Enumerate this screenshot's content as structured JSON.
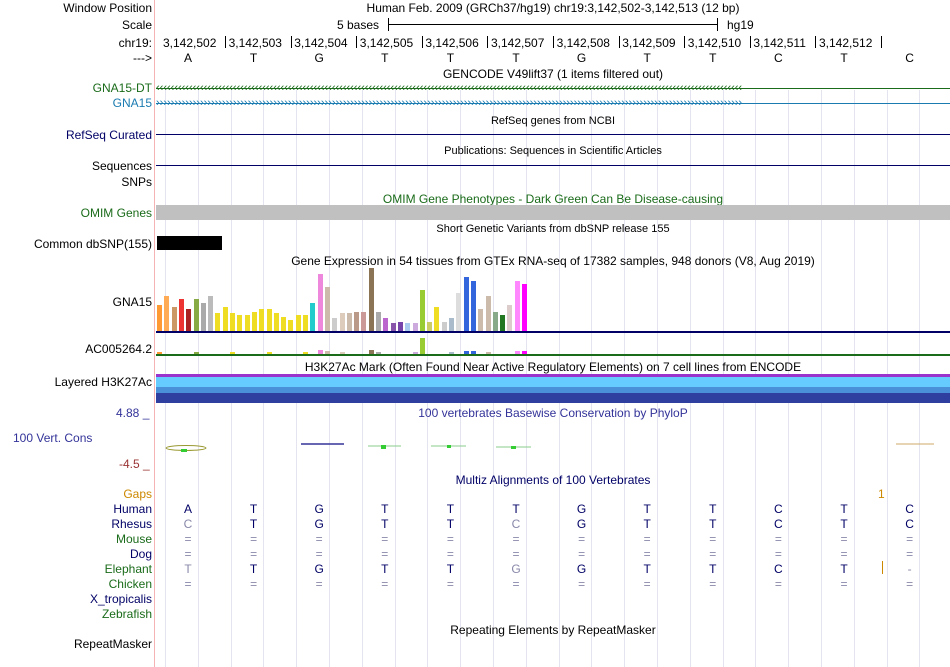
{
  "header": {
    "window_position_label": "Window Position",
    "window_position_value": "Human Feb. 2009 (GRCh37/hg19)   chr19:3,142,502-3,142,513 (12 bp)",
    "scale_label": "Scale",
    "scale_value": "5 bases",
    "scale_assembly": "hg19",
    "chrom_label": "chr19:",
    "arrow_label": "--->",
    "positions": [
      "3,142,502",
      "3,142,503",
      "3,142,504",
      "3,142,505",
      "3,142,506",
      "3,142,507",
      "3,142,508",
      "3,142,509",
      "3,142,510",
      "3,142,511",
      "3,142,512"
    ],
    "bases": [
      "A",
      "T",
      "G",
      "T",
      "T",
      "T",
      "G",
      "T",
      "T",
      "C",
      "T",
      "C"
    ]
  },
  "gencode": {
    "title": "GENCODE V49lift37 (1 items filtered out)",
    "tracks": [
      {
        "label": "GNA15-DT",
        "color": "#1a6b1a",
        "arrow": "‹"
      },
      {
        "label": "GNA15",
        "color": "#1a7bb0",
        "arrow": "›"
      }
    ]
  },
  "refseq": {
    "title": "RefSeq genes from NCBI",
    "label": "RefSeq Curated"
  },
  "publications": {
    "title": "Publications: Sequences in Scientific Articles",
    "label": "Sequences"
  },
  "snps": {
    "label": "SNPs"
  },
  "omim": {
    "title": "OMIM Gene Phenotypes - Dark Green Can Be Disease-causing",
    "label": "OMIM Genes"
  },
  "dbsnp": {
    "title": "Short Genetic Variants from dbSNP release 155",
    "label": "Common dbSNP(155)"
  },
  "gtex": {
    "title": "Gene Expression in 54 tissues from GTEx RNA-seq of 17382 samples, 948 donors (V8, Aug 2019)",
    "gene1": "GNA15",
    "gene2": "AC005264.2",
    "bars": [
      {
        "v": 0.42,
        "c": "#ff9933"
      },
      {
        "v": 0.55,
        "c": "#ffaa55"
      },
      {
        "v": 0.38,
        "c": "#cc9966"
      },
      {
        "v": 0.5,
        "c": "#ee3333"
      },
      {
        "v": 0.35,
        "c": "#aa2222"
      },
      {
        "v": 0.5,
        "c": "#88aa44"
      },
      {
        "v": 0.45,
        "c": "#aaaaaa"
      },
      {
        "v": 0.55,
        "c": "#bbbbbb"
      },
      {
        "v": 0.28,
        "c": "#eedd22"
      },
      {
        "v": 0.38,
        "c": "#eedd22"
      },
      {
        "v": 0.28,
        "c": "#eedd22"
      },
      {
        "v": 0.25,
        "c": "#eedd22"
      },
      {
        "v": 0.25,
        "c": "#eedd22"
      },
      {
        "v": 0.3,
        "c": "#eedd22"
      },
      {
        "v": 0.35,
        "c": "#eedd22"
      },
      {
        "v": 0.35,
        "c": "#eedd22"
      },
      {
        "v": 0.28,
        "c": "#eedd22"
      },
      {
        "v": 0.22,
        "c": "#eedd22"
      },
      {
        "v": 0.18,
        "c": "#eedd22"
      },
      {
        "v": 0.25,
        "c": "#eedd22"
      },
      {
        "v": 0.25,
        "c": "#eedd22"
      },
      {
        "v": 0.45,
        "c": "#22cccc"
      },
      {
        "v": 0.9,
        "c": "#ee88dd"
      },
      {
        "v": 0.7,
        "c": "#ccbbaa"
      },
      {
        "v": 0.2,
        "c": "#cccccc"
      },
      {
        "v": 0.28,
        "c": "#ddccbb"
      },
      {
        "v": 0.28,
        "c": "#ccbbaa"
      },
      {
        "v": 0.3,
        "c": "#bb9988"
      },
      {
        "v": 0.3,
        "c": "#cc9999"
      },
      {
        "v": 1.0,
        "c": "#8b7355"
      },
      {
        "v": 0.3,
        "c": "#aaaaaa"
      },
      {
        "v": 0.2,
        "c": "#bb66cc"
      },
      {
        "v": 0.12,
        "c": "#8855aa"
      },
      {
        "v": 0.15,
        "c": "#7744aa"
      },
      {
        "v": 0.12,
        "c": "#aaccee"
      },
      {
        "v": 0.12,
        "c": "#ccaadd"
      },
      {
        "v": 0.65,
        "c": "#99cc33"
      },
      {
        "v": 0.15,
        "c": "#cccc66"
      },
      {
        "v": 0.38,
        "c": "#eedd22"
      },
      {
        "v": 0.15,
        "c": "#cccccc"
      },
      {
        "v": 0.2,
        "c": "#aabbcc"
      },
      {
        "v": 0.6,
        "c": "#dddddd"
      },
      {
        "v": 0.85,
        "c": "#3366dd"
      },
      {
        "v": 0.8,
        "c": "#3366dd"
      },
      {
        "v": 0.35,
        "c": "#ccbbaa"
      },
      {
        "v": 0.55,
        "c": "#ccbbaa"
      },
      {
        "v": 0.3,
        "c": "#88aa88"
      },
      {
        "v": 0.25,
        "c": "#227722"
      },
      {
        "v": 0.42,
        "c": "#ddcccc"
      },
      {
        "v": 0.8,
        "c": "#ff88ff"
      },
      {
        "v": 0.75,
        "c": "#ff00ff"
      }
    ]
  },
  "h3k27ac": {
    "title": "H3K27Ac Mark (Often Found Near Active Regulatory Elements) on 7 cell lines from ENCODE",
    "label": "Layered H3K27Ac"
  },
  "cons": {
    "title": "100 vertebrates Basewise Conservation by PhyloP",
    "label": "100 Vert. Cons",
    "max": "4.88 _",
    "min": "-4.5 _"
  },
  "multiz": {
    "title": "Multiz Alignments of 100 Vertebrates",
    "gaps_label": "Gaps",
    "gaps_value": "1",
    "species": [
      {
        "name": "Human",
        "color": "#000066",
        "seq": [
          "A",
          "T",
          "G",
          "T",
          "T",
          "T",
          "G",
          "T",
          "T",
          "C",
          "T",
          "C"
        ],
        "seqcolor": "#000066"
      },
      {
        "name": "Rhesus",
        "color": "#000066",
        "seq": [
          "C",
          "T",
          "G",
          "T",
          "T",
          "C",
          "G",
          "T",
          "T",
          "C",
          "T",
          "C"
        ],
        "seqcolor": "#000066"
      },
      {
        "name": "Mouse",
        "color": "#1a6b1a",
        "seq": [
          "=",
          "=",
          "=",
          "=",
          "=",
          "=",
          "=",
          "=",
          "=",
          "=",
          "=",
          "="
        ],
        "seqcolor": "#8888aa"
      },
      {
        "name": "Dog",
        "color": "#000066",
        "seq": [
          "=",
          "=",
          "=",
          "=",
          "=",
          "=",
          "=",
          "=",
          "=",
          "=",
          "=",
          "="
        ],
        "seqcolor": "#8888aa"
      },
      {
        "name": "Elephant",
        "color": "#1a6b1a",
        "seq": [
          "T",
          "T",
          "G",
          "T",
          "T",
          "G",
          "G",
          "T",
          "T",
          "C",
          "T",
          "-"
        ],
        "seqcolor": "#000066"
      },
      {
        "name": "Chicken",
        "color": "#1a6b1a",
        "seq": [
          "=",
          "=",
          "=",
          "=",
          "=",
          "=",
          "=",
          "=",
          "=",
          "=",
          "=",
          "="
        ],
        "seqcolor": "#8888aa"
      },
      {
        "name": "X_tropicalis",
        "color": "#000066",
        "seq": [],
        "seqcolor": "#000066"
      },
      {
        "name": "Zebrafish",
        "color": "#1a6b1a",
        "seq": [],
        "seqcolor": "#000066"
      }
    ]
  },
  "repeatmasker": {
    "title": "Repeating Elements by RepeatMasker",
    "label": "RepeatMasker"
  },
  "colors": {
    "navy": "#000066",
    "green": "#1a6b1a",
    "blue": "#1a7bb0",
    "omim_bar": "#c0c0c0",
    "cons_title": "#333399"
  }
}
